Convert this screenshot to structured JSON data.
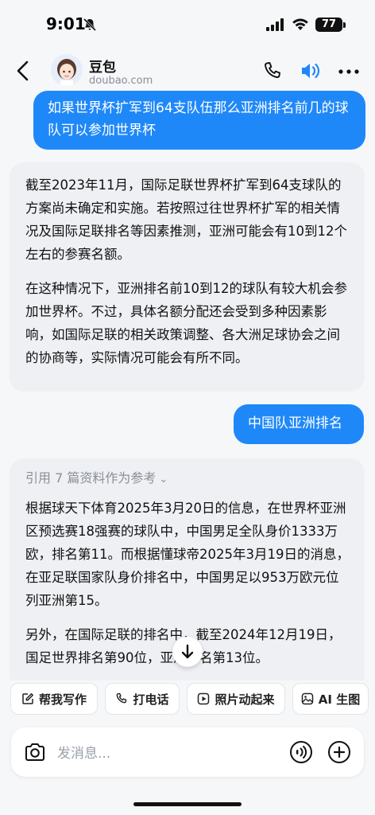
{
  "status_bar": {
    "time": "9:01",
    "battery": "77"
  },
  "header": {
    "bot_name": "豆包",
    "bot_site": "doubao.com"
  },
  "messages": [
    {
      "role": "user",
      "text": "如果世界杯扩军到64支队伍那么亚洲排名前几的球队可以参加世界杯"
    },
    {
      "role": "assistant",
      "paragraphs": [
        "截至2023年11月，国际足联世界杯扩军到64支球队的方案尚未确定和实施。若按照过往世界杯扩军的相关情况及国际足联排名等因素推测，亚洲可能会有10到12个左右的参赛名额。",
        "在这种情况下，亚洲排名前10到12的球队有较大机会参加世界杯。不过，具体名额分配还会受到多种因素影响，如国际足联的相关政策调整、各大洲足球协会之间的协商等，实际情况可能会有所不同。"
      ]
    },
    {
      "role": "user",
      "text": "中国队亚洲排名"
    },
    {
      "role": "assistant",
      "reference": "引用 7 篇资料作为参考",
      "paragraphs": [
        "根据球天下体育2025年3月20日的信息，在世界杯亚洲区预选赛18强赛的球队中，中国男足全队身价1333万欧，排名第11。而根据懂球帝2025年3月19日的消息，在亚足联国家队身价排名中，中国男足以953万欧元位列亚洲第15。",
        "另外，在国际足联的排名中，截至2024年12月19日，国足世界排名第90位，亚洲排名第13位。"
      ]
    }
  ],
  "quick_actions": [
    {
      "label": "帮我写作",
      "icon": "edit-icon"
    },
    {
      "label": "打电话",
      "icon": "phone-icon"
    },
    {
      "label": "照片动起来",
      "icon": "play-icon"
    },
    {
      "label": "AI 生图",
      "icon": "image-icon"
    }
  ],
  "composer": {
    "placeholder": "发消息..."
  },
  "colors": {
    "accent": "#1f88f9",
    "bot_bubble": "#eef0f3",
    "background": "#f6f7f9"
  }
}
